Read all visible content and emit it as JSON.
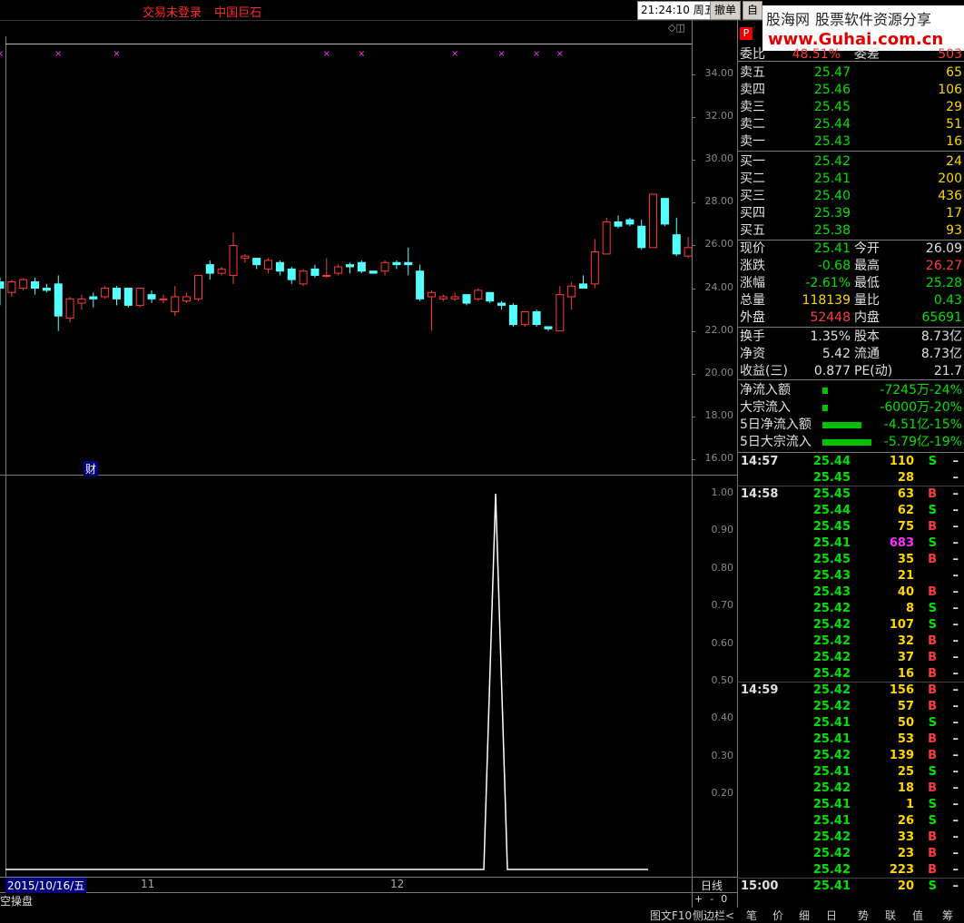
{
  "topbar": {
    "status_text": "交易未登录",
    "stock_name": "中国巨石",
    "clock": "21:24:10 周五",
    "btn_cancel": "撤单",
    "btn_auto": "自"
  },
  "logo": {
    "name": "股海网",
    "slogan": "股票软件资源分享",
    "url": "www.Guhai.com.cn"
  },
  "chart": {
    "price_ticks": [
      "34.00",
      "32.00",
      "30.00",
      "28.00",
      "26.00",
      "24.00",
      "22.00",
      "20.00",
      "18.00",
      "16.00"
    ],
    "indicator_ticks": [
      "1.00",
      "0.90",
      "0.80",
      "0.70",
      "0.60",
      "0.50",
      "0.40",
      "0.30",
      "0.20"
    ],
    "date_label": "2015/10/16/五",
    "month_labels": [
      "11",
      "12"
    ],
    "period": "日线",
    "zoom": [
      "+",
      "-",
      "0"
    ],
    "finance_mark": "财",
    "formula_name": "空操盘",
    "candles": [
      [
        24.3,
        24.0,
        24.5,
        23.2
      ],
      [
        23.8,
        24.3,
        24.4,
        23.6
      ],
      [
        24.0,
        24.4,
        24.5,
        23.9
      ],
      [
        24.3,
        24.0,
        24.5,
        23.7
      ],
      [
        24.0,
        23.9,
        24.2,
        23.8
      ],
      [
        24.2,
        22.7,
        24.6,
        22.0
      ],
      [
        22.6,
        23.5,
        23.6,
        22.4
      ],
      [
        23.3,
        23.5,
        23.7,
        23.0
      ],
      [
        23.6,
        23.5,
        23.8,
        23.1
      ],
      [
        23.6,
        24.0,
        24.1,
        23.5
      ],
      [
        24.0,
        23.5,
        24.1,
        23.2
      ],
      [
        24.0,
        23.2,
        24.0,
        23.1
      ],
      [
        23.2,
        24.0,
        24.0,
        23.1
      ],
      [
        23.7,
        23.5,
        23.9,
        23.3
      ],
      [
        23.5,
        23.5,
        23.7,
        23.3
      ],
      [
        22.9,
        23.6,
        24.1,
        22.7
      ],
      [
        23.4,
        23.6,
        23.8,
        23.3
      ],
      [
        23.5,
        24.6,
        24.6,
        23.4
      ],
      [
        25.1,
        24.7,
        25.3,
        24.4
      ],
      [
        24.7,
        24.9,
        25.0,
        24.6
      ],
      [
        24.6,
        26.0,
        26.6,
        24.2
      ],
      [
        25.4,
        25.5,
        25.6,
        25.2
      ],
      [
        25.4,
        25.1,
        25.4,
        24.9
      ],
      [
        24.9,
        25.3,
        25.4,
        24.7
      ],
      [
        25.2,
        24.8,
        25.3,
        24.6
      ],
      [
        24.9,
        24.4,
        25.0,
        24.2
      ],
      [
        24.2,
        24.8,
        24.9,
        24.1
      ],
      [
        24.9,
        24.6,
        25.1,
        24.5
      ],
      [
        24.6,
        24.6,
        25.4,
        24.5
      ],
      [
        24.7,
        25.0,
        25.1,
        24.6
      ],
      [
        25.1,
        25.0,
        25.2,
        24.7
      ],
      [
        25.2,
        24.8,
        25.3,
        24.7
      ],
      [
        24.8,
        24.7,
        24.8,
        24.7
      ],
      [
        24.8,
        25.2,
        25.3,
        24.6
      ],
      [
        25.2,
        25.1,
        25.3,
        24.9
      ],
      [
        25.2,
        25.1,
        25.9,
        24.6
      ],
      [
        24.8,
        23.5,
        25.1,
        23.4
      ],
      [
        23.6,
        23.8,
        23.9,
        22.0
      ],
      [
        23.5,
        23.6,
        23.7,
        23.4
      ],
      [
        23.5,
        23.6,
        23.8,
        23.4
      ],
      [
        23.7,
        23.3,
        23.7,
        23.2
      ],
      [
        23.5,
        23.9,
        24.0,
        23.4
      ],
      [
        23.8,
        23.4,
        23.8,
        23.3
      ],
      [
        23.3,
        23.2,
        23.4,
        23.0
      ],
      [
        23.2,
        22.3,
        23.3,
        22.2
      ],
      [
        22.3,
        22.9,
        22.9,
        22.2
      ],
      [
        22.9,
        22.3,
        23.0,
        22.2
      ],
      [
        22.2,
        22.1,
        22.2,
        22.0
      ],
      [
        22.0,
        23.7,
        24.1,
        22.0
      ],
      [
        23.6,
        24.1,
        24.3,
        23.0
      ],
      [
        24.2,
        24.0,
        24.6,
        24.0
      ],
      [
        24.2,
        25.7,
        26.3,
        24.0
      ],
      [
        25.6,
        27.1,
        27.3,
        25.6
      ],
      [
        27.1,
        26.9,
        27.4,
        26.8
      ],
      [
        27.2,
        27.0,
        27.3,
        26.9
      ],
      [
        26.9,
        25.9,
        27.2,
        25.8
      ],
      [
        25.9,
        28.4,
        28.4,
        25.9
      ],
      [
        28.2,
        27.0,
        28.0,
        26.9
      ],
      [
        26.5,
        25.6,
        27.3,
        25.5
      ],
      [
        25.5,
        25.9,
        26.4,
        25.4
      ],
      [
        25.9,
        26.0,
        26.4,
        25.7
      ],
      [
        26.1,
        25.4,
        26.2,
        25.3
      ]
    ],
    "signal_marks": [
      0,
      5,
      10,
      28,
      31,
      39,
      43,
      46,
      48,
      65,
      69
    ],
    "peak": {
      "index": 52,
      "value": 1.0
    }
  },
  "quote": {
    "header": [
      {
        "label": "委比",
        "value": "48.51%",
        "label2": "委差",
        "value2": "503"
      }
    ],
    "asks": [
      {
        "label": "卖五",
        "price": "25.47",
        "vol": "65"
      },
      {
        "label": "卖四",
        "price": "25.46",
        "vol": "106"
      },
      {
        "label": "卖三",
        "price": "25.45",
        "vol": "29"
      },
      {
        "label": "卖二",
        "price": "25.44",
        "vol": "51"
      },
      {
        "label": "卖一",
        "price": "25.43",
        "vol": "16"
      }
    ],
    "bids": [
      {
        "label": "买一",
        "price": "25.42",
        "vol": "24"
      },
      {
        "label": "买二",
        "price": "25.41",
        "vol": "200"
      },
      {
        "label": "买三",
        "price": "25.40",
        "vol": "436"
      },
      {
        "label": "买四",
        "price": "25.39",
        "vol": "17"
      },
      {
        "label": "买五",
        "price": "25.38",
        "vol": "93"
      }
    ],
    "stats": [
      {
        "l1": "现价",
        "v1": "25.41",
        "c1": "green",
        "l2": "今开",
        "v2": "26.09",
        "c2": "white"
      },
      {
        "l1": "涨跌",
        "v1": "-0.68",
        "c1": "green",
        "l2": "最高",
        "v2": "26.27",
        "c2": "red"
      },
      {
        "l1": "涨幅",
        "v1": "-2.61%",
        "c1": "green",
        "l2": "最低",
        "v2": "25.28",
        "c2": "green"
      },
      {
        "l1": "总量",
        "v1": "118139",
        "c1": "yellow",
        "l2": "量比",
        "v2": "0.43",
        "c2": "green"
      },
      {
        "l1": "外盘",
        "v1": "52448",
        "c1": "red",
        "l2": "内盘",
        "v2": "65691",
        "c2": "green"
      }
    ],
    "fund": [
      {
        "l1": "换手",
        "v1": "1.35%",
        "l2": "股本",
        "v2": "8.73亿"
      },
      {
        "l1": "净资",
        "v1": "5.42",
        "l2": "流通",
        "v2": "8.73亿"
      },
      {
        "l1": "收益(三)",
        "v1": "0.877",
        "l2": "PE(动)",
        "v2": "21.7"
      }
    ],
    "flows": [
      {
        "label": "净流入额",
        "amount": "-7245万",
        "pct": "-24%",
        "bar": 0.03
      },
      {
        "label": "大宗流入",
        "amount": "-6000万",
        "pct": "-20%",
        "bar": 0.03
      },
      {
        "label": "5日净流入额",
        "amount": "-4.51亿",
        "pct": "-15%",
        "bar": 0.8
      },
      {
        "label": "5日大宗流入",
        "amount": "-5.79亿",
        "pct": "-19%",
        "bar": 1.0
      }
    ]
  },
  "ticks": [
    {
      "time": "14:57",
      "price": "25.44",
      "vol": "110",
      "side": "S"
    },
    {
      "time": "",
      "price": "25.45",
      "vol": "28",
      "side": ""
    },
    {
      "time": "14:58",
      "price": "25.45",
      "vol": "63",
      "side": "B"
    },
    {
      "time": "",
      "price": "25.44",
      "vol": "62",
      "side": "S"
    },
    {
      "time": "",
      "price": "25.45",
      "vol": "75",
      "side": "B"
    },
    {
      "time": "",
      "price": "25.41",
      "vol": "683",
      "side": "S"
    },
    {
      "time": "",
      "price": "25.45",
      "vol": "35",
      "side": "B"
    },
    {
      "time": "",
      "price": "25.43",
      "vol": "21",
      "side": ""
    },
    {
      "time": "",
      "price": "25.43",
      "vol": "40",
      "side": "B"
    },
    {
      "time": "",
      "price": "25.42",
      "vol": "8",
      "side": "S"
    },
    {
      "time": "",
      "price": "25.42",
      "vol": "107",
      "side": "S"
    },
    {
      "time": "",
      "price": "25.42",
      "vol": "32",
      "side": "B"
    },
    {
      "time": "",
      "price": "25.42",
      "vol": "37",
      "side": "B"
    },
    {
      "time": "",
      "price": "25.42",
      "vol": "16",
      "side": "B"
    },
    {
      "time": "14:59",
      "price": "25.42",
      "vol": "156",
      "side": "B"
    },
    {
      "time": "",
      "price": "25.42",
      "vol": "57",
      "side": "B"
    },
    {
      "time": "",
      "price": "25.41",
      "vol": "50",
      "side": "S"
    },
    {
      "time": "",
      "price": "25.41",
      "vol": "53",
      "side": "B"
    },
    {
      "time": "",
      "price": "25.42",
      "vol": "139",
      "side": "B"
    },
    {
      "time": "",
      "price": "25.41",
      "vol": "25",
      "side": "S"
    },
    {
      "time": "",
      "price": "25.42",
      "vol": "18",
      "side": "B"
    },
    {
      "time": "",
      "price": "25.41",
      "vol": "1",
      "side": "S"
    },
    {
      "time": "",
      "price": "25.41",
      "vol": "26",
      "side": "S"
    },
    {
      "time": "",
      "price": "25.42",
      "vol": "33",
      "side": "B"
    },
    {
      "time": "",
      "price": "25.42",
      "vol": "23",
      "side": "B"
    },
    {
      "time": "",
      "price": "25.42",
      "vol": "223",
      "side": "B"
    },
    {
      "time": "15:00",
      "price": "25.41",
      "vol": "20",
      "side": "S"
    }
  ],
  "bottom_tabs": [
    "图文F10",
    "侧边栏<",
    "笔",
    "价",
    "细",
    "日",
    "势",
    "联",
    "值",
    "筹"
  ]
}
